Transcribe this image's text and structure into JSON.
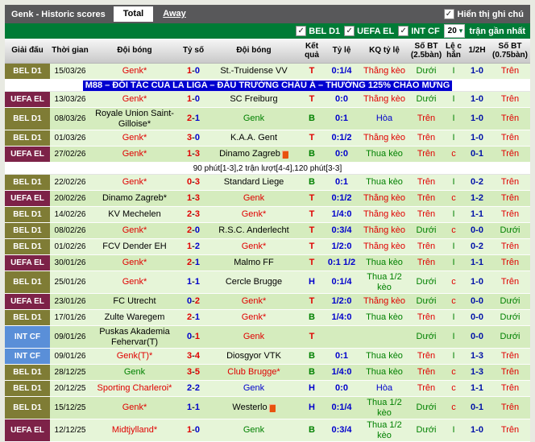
{
  "titlebar": {
    "title": "Genk - Historic scores",
    "tabs": [
      {
        "label": "Total",
        "active": true
      },
      {
        "label": "Away",
        "active": false
      }
    ],
    "show_notes_label": "Hiển thị ghi chú",
    "show_notes_checked": true
  },
  "filterbar": {
    "leagues": [
      {
        "label": "BEL D1",
        "checked": true
      },
      {
        "label": "UEFA EL",
        "checked": true
      },
      {
        "label": "INT CF",
        "checked": true
      }
    ],
    "count_value": "20",
    "count_suffix": "trận gần nhất"
  },
  "colors": {
    "red": "#e00000",
    "green": "#008000",
    "blue": "#0000cc",
    "black": "#000000",
    "league_bel": "#7f7c35",
    "league_uefa": "#7d2248",
    "league_int": "#5a8fd8",
    "row_light": "#e6f5d8",
    "row_dark": "#d5ecbe"
  },
  "table": {
    "headers": [
      "Giải đấu",
      "Thời gian",
      "Đội bóng",
      "Tỷ số",
      "Đội bóng",
      "Kết quả",
      "Tỷ lệ",
      "KQ tỷ lệ",
      "Số BT (2.5bàn)",
      "Lệ c hẳn",
      "1/2H",
      "Số BT (0.75bàn)"
    ],
    "rows": [
      {
        "kind": "match",
        "league": "BEL D1",
        "league_color": "league_bel",
        "date": "15/03/26",
        "home": "Genk*",
        "home_color": "red",
        "home_icon": false,
        "score": [
          "1",
          "0"
        ],
        "score_colors": [
          "red",
          "blue"
        ],
        "away": "St.-Truidense VV",
        "away_color": "black",
        "away_icon": false,
        "result": "T",
        "result_color": "red",
        "odds": "0:1/4",
        "odds_result": "Thắng kèo",
        "odds_result_color": "red",
        "ou25": "Dưới",
        "ou25_color": "green",
        "leg": "I",
        "leg_color": "green",
        "half": "1-0",
        "ou075": "Trên",
        "ou075_color": "red",
        "tall": false
      },
      {
        "kind": "ad",
        "text": "M88 – ĐỐI TÁC CỦA LA LIGA – ĐẤU TRƯỜNG CHÂU Á – THƯỞNG 125% CHÀO MỪNG"
      },
      {
        "kind": "match",
        "league": "UEFA EL",
        "league_color": "league_uefa",
        "date": "13/03/26",
        "home": "Genk*",
        "home_color": "red",
        "home_icon": false,
        "score": [
          "1",
          "0"
        ],
        "score_colors": [
          "red",
          "blue"
        ],
        "away": "SC Freiburg",
        "away_color": "black",
        "away_icon": false,
        "result": "T",
        "result_color": "red",
        "odds": "0:0",
        "odds_result": "Thắng kèo",
        "odds_result_color": "red",
        "ou25": "Dưới",
        "ou25_color": "green",
        "leg": "I",
        "leg_color": "green",
        "half": "1-0",
        "ou075": "Trên",
        "ou075_color": "red",
        "tall": false
      },
      {
        "kind": "match",
        "league": "BEL D1",
        "league_color": "league_bel",
        "date": "08/03/26",
        "home": "Royale Union Saint-Gilloise*",
        "home_color": "black",
        "home_icon": false,
        "score": [
          "2",
          "1"
        ],
        "score_colors": [
          "red",
          "blue"
        ],
        "away": "Genk",
        "away_color": "green",
        "away_icon": false,
        "result": "B",
        "result_color": "green",
        "odds": "0:1",
        "odds_result": "Hòa",
        "odds_result_color": "blue",
        "ou25": "Trên",
        "ou25_color": "red",
        "leg": "I",
        "leg_color": "green",
        "half": "1-0",
        "ou075": "Trên",
        "ou075_color": "red",
        "tall": true
      },
      {
        "kind": "match",
        "league": "BEL D1",
        "league_color": "league_bel",
        "date": "01/03/26",
        "home": "Genk*",
        "home_color": "red",
        "home_icon": false,
        "score": [
          "3",
          "0"
        ],
        "score_colors": [
          "red",
          "blue"
        ],
        "away": "K.A.A. Gent",
        "away_color": "black",
        "away_icon": false,
        "result": "T",
        "result_color": "red",
        "odds": "0:1/2",
        "odds_result": "Thắng kèo",
        "odds_result_color": "red",
        "ou25": "Trên",
        "ou25_color": "red",
        "leg": "I",
        "leg_color": "green",
        "half": "1-0",
        "ou075": "Trên",
        "ou075_color": "red",
        "tall": false
      },
      {
        "kind": "match",
        "league": "UEFA EL",
        "league_color": "league_uefa",
        "date": "27/02/26",
        "home": "Genk*",
        "home_color": "red",
        "home_icon": false,
        "score": [
          "1",
          "3"
        ],
        "score_colors": [
          "red",
          "red"
        ],
        "away": "Dinamo Zagreb",
        "away_color": "black",
        "away_icon": true,
        "result": "B",
        "result_color": "green",
        "odds": "0:0",
        "odds_result": "Thua kèo",
        "odds_result_color": "green",
        "ou25": "Trên",
        "ou25_color": "red",
        "leg": "c",
        "leg_color": "red",
        "half": "0-1",
        "ou075": "Trên",
        "ou075_color": "red",
        "tall": false
      },
      {
        "kind": "note",
        "text": "90 phút[1-3],2 trận lượt[4-4],120 phút[3-3]"
      },
      {
        "kind": "match",
        "league": "BEL D1",
        "league_color": "league_bel",
        "date": "22/02/26",
        "home": "Genk*",
        "home_color": "red",
        "home_icon": false,
        "score": [
          "0",
          "3"
        ],
        "score_colors": [
          "red",
          "red"
        ],
        "away": "Standard Liege",
        "away_color": "black",
        "away_icon": false,
        "result": "B",
        "result_color": "green",
        "odds": "0:1",
        "odds_result": "Thua kèo",
        "odds_result_color": "green",
        "ou25": "Trên",
        "ou25_color": "red",
        "leg": "I",
        "leg_color": "green",
        "half": "0-2",
        "ou075": "Trên",
        "ou075_color": "red",
        "tall": false
      },
      {
        "kind": "match",
        "league": "UEFA EL",
        "league_color": "league_uefa",
        "date": "20/02/26",
        "home": "Dinamo Zagreb*",
        "home_color": "black",
        "home_icon": false,
        "score": [
          "1",
          "3"
        ],
        "score_colors": [
          "red",
          "red"
        ],
        "away": "Genk",
        "away_color": "red",
        "away_icon": false,
        "result": "T",
        "result_color": "red",
        "odds": "0:1/2",
        "odds_result": "Thắng kèo",
        "odds_result_color": "red",
        "ou25": "Trên",
        "ou25_color": "red",
        "leg": "c",
        "leg_color": "red",
        "half": "1-2",
        "ou075": "Trên",
        "ou075_color": "red",
        "tall": false
      },
      {
        "kind": "match",
        "league": "BEL D1",
        "league_color": "league_bel",
        "date": "14/02/26",
        "home": "KV Mechelen",
        "home_color": "black",
        "home_icon": false,
        "score": [
          "2",
          "3"
        ],
        "score_colors": [
          "red",
          "red"
        ],
        "away": "Genk*",
        "away_color": "red",
        "away_icon": false,
        "result": "T",
        "result_color": "red",
        "odds": "1/4:0",
        "odds_result": "Thắng kèo",
        "odds_result_color": "red",
        "ou25": "Trên",
        "ou25_color": "red",
        "leg": "I",
        "leg_color": "green",
        "half": "1-1",
        "ou075": "Trên",
        "ou075_color": "red",
        "tall": false
      },
      {
        "kind": "match",
        "league": "BEL D1",
        "league_color": "league_bel",
        "date": "08/02/26",
        "home": "Genk*",
        "home_color": "red",
        "home_icon": false,
        "score": [
          "2",
          "0"
        ],
        "score_colors": [
          "red",
          "blue"
        ],
        "away": "R.S.C. Anderlecht",
        "away_color": "black",
        "away_icon": false,
        "result": "T",
        "result_color": "red",
        "odds": "0:3/4",
        "odds_result": "Thắng kèo",
        "odds_result_color": "red",
        "ou25": "Dưới",
        "ou25_color": "green",
        "leg": "c",
        "leg_color": "red",
        "half": "0-0",
        "ou075": "Dưới",
        "ou075_color": "green",
        "tall": false
      },
      {
        "kind": "match",
        "league": "BEL D1",
        "league_color": "league_bel",
        "date": "01/02/26",
        "home": "FCV Dender EH",
        "home_color": "black",
        "home_icon": false,
        "score": [
          "1",
          "2"
        ],
        "score_colors": [
          "red",
          "blue"
        ],
        "away": "Genk*",
        "away_color": "red",
        "away_icon": false,
        "result": "T",
        "result_color": "red",
        "odds": "1/2:0",
        "odds_result": "Thắng kèo",
        "odds_result_color": "red",
        "ou25": "Trên",
        "ou25_color": "red",
        "leg": "I",
        "leg_color": "green",
        "half": "0-2",
        "ou075": "Trên",
        "ou075_color": "red",
        "tall": false
      },
      {
        "kind": "match",
        "league": "UEFA EL",
        "league_color": "league_uefa",
        "date": "30/01/26",
        "home": "Genk*",
        "home_color": "red",
        "home_icon": false,
        "score": [
          "2",
          "1"
        ],
        "score_colors": [
          "red",
          "blue"
        ],
        "away": "Malmo FF",
        "away_color": "black",
        "away_icon": false,
        "result": "T",
        "result_color": "red",
        "odds": "0:1 1/2",
        "odds_result": "Thua kèo",
        "odds_result_color": "green",
        "ou25": "Trên",
        "ou25_color": "red",
        "leg": "I",
        "leg_color": "green",
        "half": "1-1",
        "ou075": "Trên",
        "ou075_color": "red",
        "tall": false
      },
      {
        "kind": "match",
        "league": "BEL D1",
        "league_color": "league_bel",
        "date": "25/01/26",
        "home": "Genk*",
        "home_color": "red",
        "home_icon": false,
        "score": [
          "1",
          "1"
        ],
        "score_colors": [
          "blue",
          "blue"
        ],
        "away": "Cercle Brugge",
        "away_color": "black",
        "away_icon": false,
        "result": "H",
        "result_color": "blue",
        "odds": "0:1/4",
        "odds_result": "Thua 1/2 kèo",
        "odds_result_color": "green",
        "ou25": "Dưới",
        "ou25_color": "green",
        "leg": "c",
        "leg_color": "red",
        "half": "1-0",
        "ou075": "Trên",
        "ou075_color": "red",
        "tall": true
      },
      {
        "kind": "match",
        "league": "UEFA EL",
        "league_color": "league_uefa",
        "date": "23/01/26",
        "home": "FC Utrecht",
        "home_color": "black",
        "home_icon": false,
        "score": [
          "0",
          "2"
        ],
        "score_colors": [
          "blue",
          "red"
        ],
        "away": "Genk*",
        "away_color": "red",
        "away_icon": false,
        "result": "T",
        "result_color": "red",
        "odds": "1/2:0",
        "odds_result": "Thắng kèo",
        "odds_result_color": "red",
        "ou25": "Dưới",
        "ou25_color": "green",
        "leg": "c",
        "leg_color": "red",
        "half": "0-0",
        "ou075": "Dưới",
        "ou075_color": "green",
        "tall": false
      },
      {
        "kind": "match",
        "league": "BEL D1",
        "league_color": "league_bel",
        "date": "17/01/26",
        "home": "Zulte Waregem",
        "home_color": "black",
        "home_icon": false,
        "score": [
          "2",
          "1"
        ],
        "score_colors": [
          "red",
          "blue"
        ],
        "away": "Genk*",
        "away_color": "red",
        "away_icon": false,
        "result": "B",
        "result_color": "green",
        "odds": "1/4:0",
        "odds_result": "Thua kèo",
        "odds_result_color": "green",
        "ou25": "Trên",
        "ou25_color": "red",
        "leg": "I",
        "leg_color": "green",
        "half": "0-0",
        "ou075": "Dưới",
        "ou075_color": "green",
        "tall": false
      },
      {
        "kind": "match",
        "league": "INT CF",
        "league_color": "league_int",
        "date": "09/01/26",
        "home": "Puskas Akademia Fehervar(T)",
        "home_color": "black",
        "home_icon": false,
        "score": [
          "0",
          "1"
        ],
        "score_colors": [
          "blue",
          "red"
        ],
        "away": "Genk",
        "away_color": "red",
        "away_icon": false,
        "result": "T",
        "result_color": "red",
        "odds": "",
        "odds_result": "",
        "odds_result_color": "black",
        "ou25": "Dưới",
        "ou25_color": "green",
        "leg": "I",
        "leg_color": "green",
        "half": "0-0",
        "ou075": "Dưới",
        "ou075_color": "green",
        "tall": true
      },
      {
        "kind": "match",
        "league": "INT CF",
        "league_color": "league_int",
        "date": "09/01/26",
        "home": "Genk(T)*",
        "home_color": "red",
        "home_icon": false,
        "score": [
          "3",
          "4"
        ],
        "score_colors": [
          "red",
          "red"
        ],
        "away": "Diosgyor VTK",
        "away_color": "black",
        "away_icon": false,
        "result": "B",
        "result_color": "green",
        "odds": "0:1",
        "odds_result": "Thua kèo",
        "odds_result_color": "green",
        "ou25": "Trên",
        "ou25_color": "red",
        "leg": "I",
        "leg_color": "green",
        "half": "1-3",
        "ou075": "Trên",
        "ou075_color": "red",
        "tall": false
      },
      {
        "kind": "match",
        "league": "BEL D1",
        "league_color": "league_bel",
        "date": "28/12/25",
        "home": "Genk",
        "home_color": "green",
        "home_icon": false,
        "score": [
          "3",
          "5"
        ],
        "score_colors": [
          "red",
          "red"
        ],
        "away": "Club Brugge*",
        "away_color": "red",
        "away_icon": false,
        "result": "B",
        "result_color": "green",
        "odds": "1/4:0",
        "odds_result": "Thua kèo",
        "odds_result_color": "green",
        "ou25": "Trên",
        "ou25_color": "red",
        "leg": "c",
        "leg_color": "red",
        "half": "1-3",
        "ou075": "Trên",
        "ou075_color": "red",
        "tall": false
      },
      {
        "kind": "match",
        "league": "BEL D1",
        "league_color": "league_bel",
        "date": "20/12/25",
        "home": "Sporting Charleroi*",
        "home_color": "red",
        "home_icon": false,
        "score": [
          "2",
          "2"
        ],
        "score_colors": [
          "blue",
          "blue"
        ],
        "away": "Genk",
        "away_color": "blue",
        "away_icon": false,
        "result": "H",
        "result_color": "blue",
        "odds": "0:0",
        "odds_result": "Hòa",
        "odds_result_color": "blue",
        "ou25": "Trên",
        "ou25_color": "red",
        "leg": "c",
        "leg_color": "red",
        "half": "1-1",
        "ou075": "Trên",
        "ou075_color": "red",
        "tall": false
      },
      {
        "kind": "match",
        "league": "BEL D1",
        "league_color": "league_bel",
        "date": "15/12/25",
        "home": "Genk*",
        "home_color": "red",
        "home_icon": false,
        "score": [
          "1",
          "1"
        ],
        "score_colors": [
          "blue",
          "blue"
        ],
        "away": "Westerlo",
        "away_color": "black",
        "away_icon": true,
        "result": "H",
        "result_color": "blue",
        "odds": "0:1/4",
        "odds_result": "Thua 1/2 kèo",
        "odds_result_color": "green",
        "ou25": "Dưới",
        "ou25_color": "green",
        "leg": "c",
        "leg_color": "red",
        "half": "0-1",
        "ou075": "Trên",
        "ou075_color": "red",
        "tall": true
      },
      {
        "kind": "match",
        "league": "UEFA EL",
        "league_color": "league_uefa",
        "date": "12/12/25",
        "home": "Midtjylland*",
        "home_color": "red",
        "home_icon": false,
        "score": [
          "1",
          "0"
        ],
        "score_colors": [
          "red",
          "blue"
        ],
        "away": "Genk",
        "away_color": "green",
        "away_icon": false,
        "result": "B",
        "result_color": "green",
        "odds": "0:3/4",
        "odds_result": "Thua 1/2 kèo",
        "odds_result_color": "green",
        "ou25": "Dưới",
        "ou25_color": "green",
        "leg": "I",
        "leg_color": "green",
        "half": "1-0",
        "ou075": "Trên",
        "ou075_color": "red",
        "tall": true
      }
    ]
  }
}
